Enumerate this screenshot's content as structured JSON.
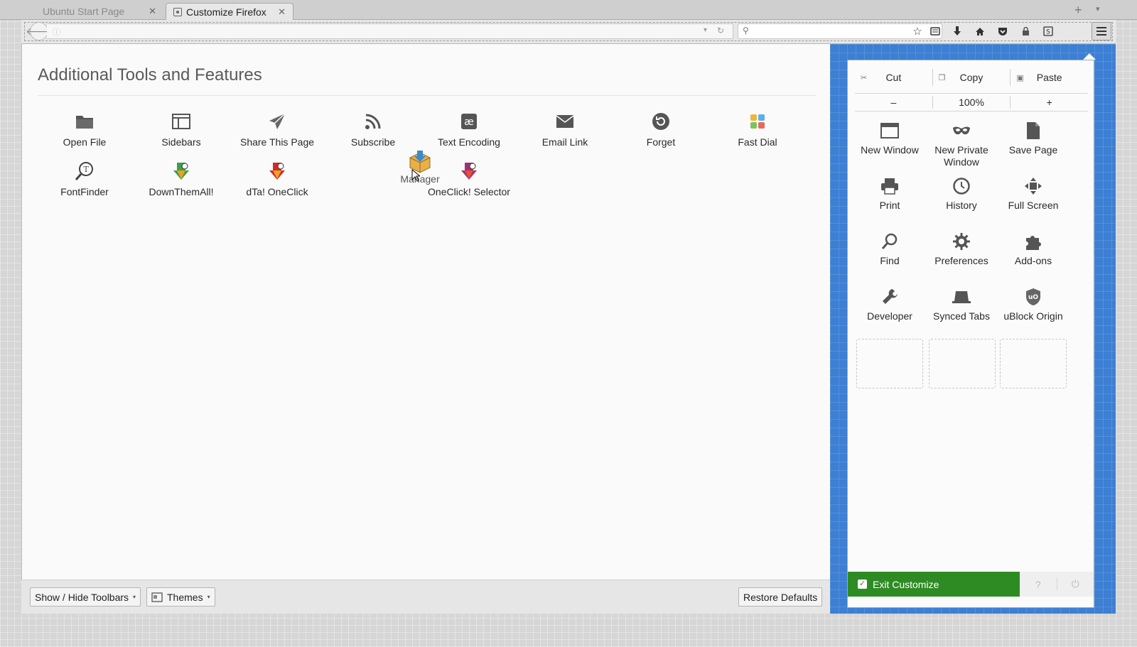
{
  "tabs": [
    {
      "label": "Ubuntu Start Page"
    },
    {
      "label": "Customize Firefox"
    }
  ],
  "palette": {
    "title": "Additional Tools and Features",
    "items": [
      {
        "label": "Open File",
        "icon": "folder-icon"
      },
      {
        "label": "Sidebars",
        "icon": "sidebar-icon"
      },
      {
        "label": "Share This Page",
        "icon": "share-plane-icon"
      },
      {
        "label": "Subscribe",
        "icon": "rss-icon"
      },
      {
        "label": "Text Encoding",
        "icon": "encoding-icon"
      },
      {
        "label": "Email Link",
        "icon": "envelope-icon"
      },
      {
        "label": "Forget",
        "icon": "forget-icon"
      },
      {
        "label": "Fast Dial",
        "icon": "fast-dial-icon"
      },
      {
        "label": "FontFinder",
        "icon": "magnifier-font-icon"
      },
      {
        "label": "DownThemAll!",
        "icon": "downthemall-icon"
      },
      {
        "label": "dTa! OneClick",
        "icon": "dta-oneclick-icon"
      },
      {
        "label": "OneClick! Selector",
        "icon": "oneclick-selector-icon"
      }
    ],
    "dragging_item": {
      "label": "Manager",
      "icon": "download-manager-icon"
    }
  },
  "footer": {
    "toolbars_label": "Show / Hide Toolbars",
    "themes_label": "Themes",
    "restore_label": "Restore Defaults"
  },
  "panel": {
    "edit": {
      "cut": "Cut",
      "copy": "Copy",
      "paste": "Paste"
    },
    "zoom": {
      "minus": "–",
      "level": "100%",
      "plus": "+"
    },
    "items": [
      {
        "label": "New Window",
        "icon": "new-window-icon"
      },
      {
        "label": "New Private Window",
        "icon": "private-mask-icon"
      },
      {
        "label": "Save Page",
        "icon": "save-page-icon"
      },
      {
        "label": "Print",
        "icon": "printer-icon"
      },
      {
        "label": "History",
        "icon": "clock-icon"
      },
      {
        "label": "Full Screen",
        "icon": "fullscreen-arrows-icon"
      },
      {
        "label": "Find",
        "icon": "find-magnifier-icon"
      },
      {
        "label": "Preferences",
        "icon": "gear-icon"
      },
      {
        "label": "Add-ons",
        "icon": "puzzle-icon"
      },
      {
        "label": "Developer",
        "icon": "wrench-icon"
      },
      {
        "label": "Synced Tabs",
        "icon": "synced-tabs-icon"
      },
      {
        "label": "uBlock Origin",
        "icon": "ublock-shield-icon"
      }
    ],
    "exit_label": "Exit Customize"
  },
  "colors": {
    "accent_green": "#2e8b24",
    "blueprint_blue": "#3c7fd3"
  }
}
